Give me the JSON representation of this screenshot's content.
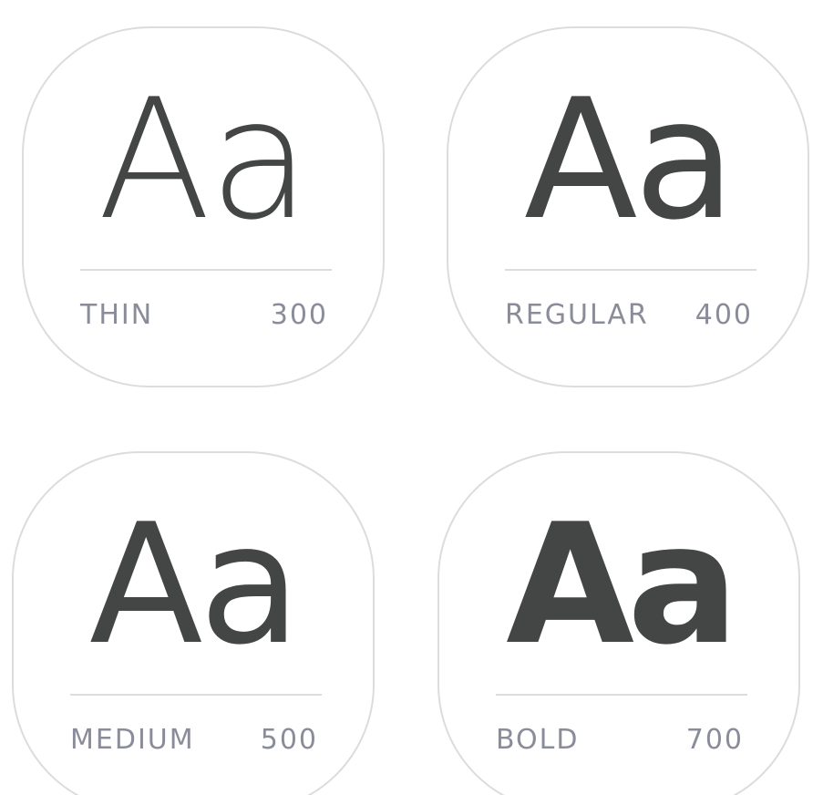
{
  "cards": [
    {
      "sample": "Aa",
      "name": "THIN",
      "weight": "300"
    },
    {
      "sample": "Aa",
      "name": "REGULAR",
      "weight": "400"
    },
    {
      "sample": "Aa",
      "name": "MEDIUM",
      "weight": "500"
    },
    {
      "sample": "Aa",
      "name": "BOLD",
      "weight": "700"
    }
  ],
  "colors": {
    "glyph": "#444545",
    "label": "#8a8d99",
    "border": "#dcdcdf",
    "background": "#ffffff"
  }
}
